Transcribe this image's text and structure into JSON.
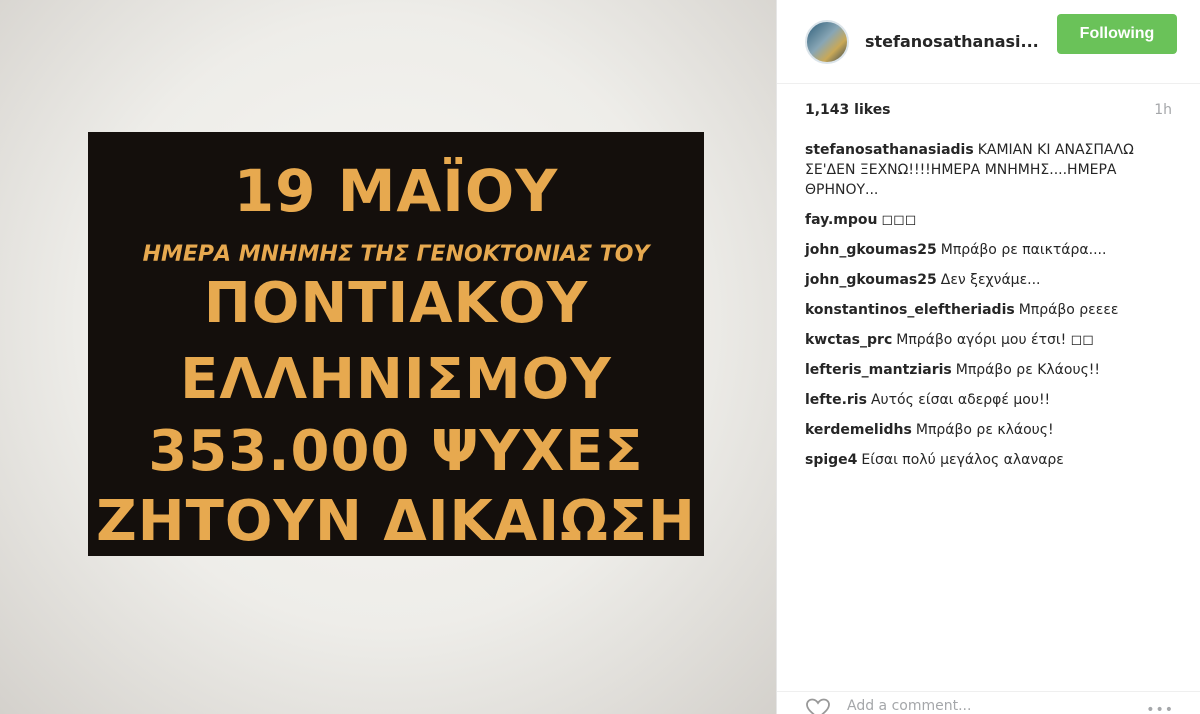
{
  "poster": {
    "line1": "19 ΜΑΪΟΥ",
    "line2": "ΗΜΕΡΑ ΜΝΗΜΗΣ ΤΗΣ ΓΕΝΟΚΤΟΝΙΑΣ ΤΟΥ",
    "line3": "ΠΟΝΤΙΑΚΟΥ",
    "line4": "ΕΛΛΗΝΙΣΜΟΥ",
    "line5": "353.000 ΨΥΧΕΣ",
    "line6": "ΖΗΤΟΥΝ ΔΙΚΑΙΩΣΗ"
  },
  "header": {
    "username": "stefanosathanasi...",
    "follow_label": "Following"
  },
  "meta": {
    "likes": "1,143 likes",
    "time": "1h"
  },
  "caption": {
    "author": "stefanosathanasiadis",
    "text": "ΚΑΜΙΑΝ ΚΙ ΑΝΑΣΠΑΛΩ ΣΕ'ΔΕΝ ΞΕΧΝΩ!!!!ΗΜΕΡΑ ΜΝΗΜΗΣ....ΗΜΕΡΑ ΘΡΗΝΟΥ..."
  },
  "comments": [
    {
      "author": "fay.mpou",
      "text": "◻◻◻"
    },
    {
      "author": "john_gkoumas25",
      "text": "Μπράβο ρε παικτάρα...."
    },
    {
      "author": "john_gkoumas25",
      "text": "Δεν ξεχνάμε..."
    },
    {
      "author": "konstantinos_eleftheriadis",
      "text": "Μπράβο ρεεεε"
    },
    {
      "author": "kwctas_prc",
      "text": "Μπράβο αγόρι μου έτσι! ◻◻"
    },
    {
      "author": "lefteris_mantziaris",
      "text": "Μπράβο ρε Κλάους!!"
    },
    {
      "author": "lefte.ris",
      "text": "Αυτός είσαι αδερφέ μου!!"
    },
    {
      "author": "kerdemelidhs",
      "text": "Μπράβο ρε κλάους!"
    },
    {
      "author": "spige4",
      "text": "Είσαι πολύ μεγάλος αλαναρε"
    }
  ],
  "footer": {
    "add_comment_placeholder": "Add a comment...",
    "more_label": "•••",
    "icons": [
      "heart-icon",
      "more-icon"
    ]
  },
  "colors": {
    "follow_green": "#6ac259",
    "poster_bg": "#140f0c",
    "poster_text": "#e7a94f",
    "muted_gray": "#a5a7aa"
  }
}
